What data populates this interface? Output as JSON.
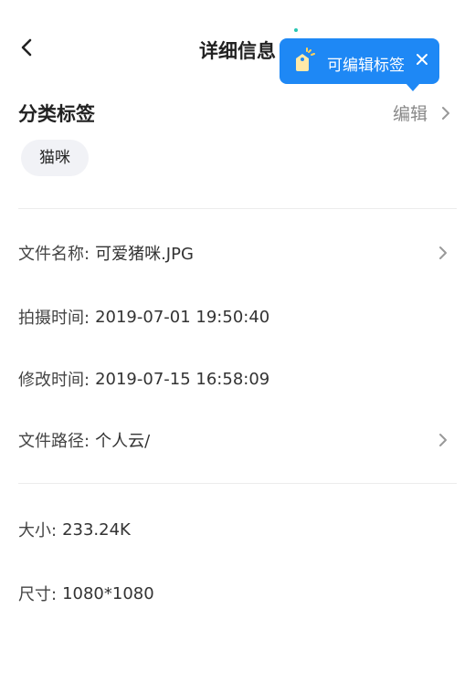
{
  "header": {
    "title": "详细信息",
    "tooltip": {
      "text": "可编辑标签",
      "close_icon": "close-icon",
      "icon": "tag-icon"
    }
  },
  "tags_section": {
    "title": "分类标签",
    "edit_label": "编辑",
    "tags": [
      "猫咪"
    ]
  },
  "file_info": [
    {
      "label": "文件名称:",
      "value": "可爱猪咪.JPG",
      "has_arrow": true
    },
    {
      "label": "拍摄时间:",
      "value": "2019-07-01 19:50:40",
      "has_arrow": false
    },
    {
      "label": "修改时间:",
      "value": "2019-07-15 16:58:09",
      "has_arrow": false
    },
    {
      "label": "文件路径:",
      "value": "个人云/",
      "has_arrow": true
    }
  ],
  "meta_info": [
    {
      "label": "大小:",
      "value": "233.24K"
    },
    {
      "label": "尺寸:",
      "value": "1080*1080"
    }
  ],
  "colors": {
    "accent": "#1E88F5",
    "chip_bg": "#F1F2F6",
    "divider": "#ECECEC"
  }
}
